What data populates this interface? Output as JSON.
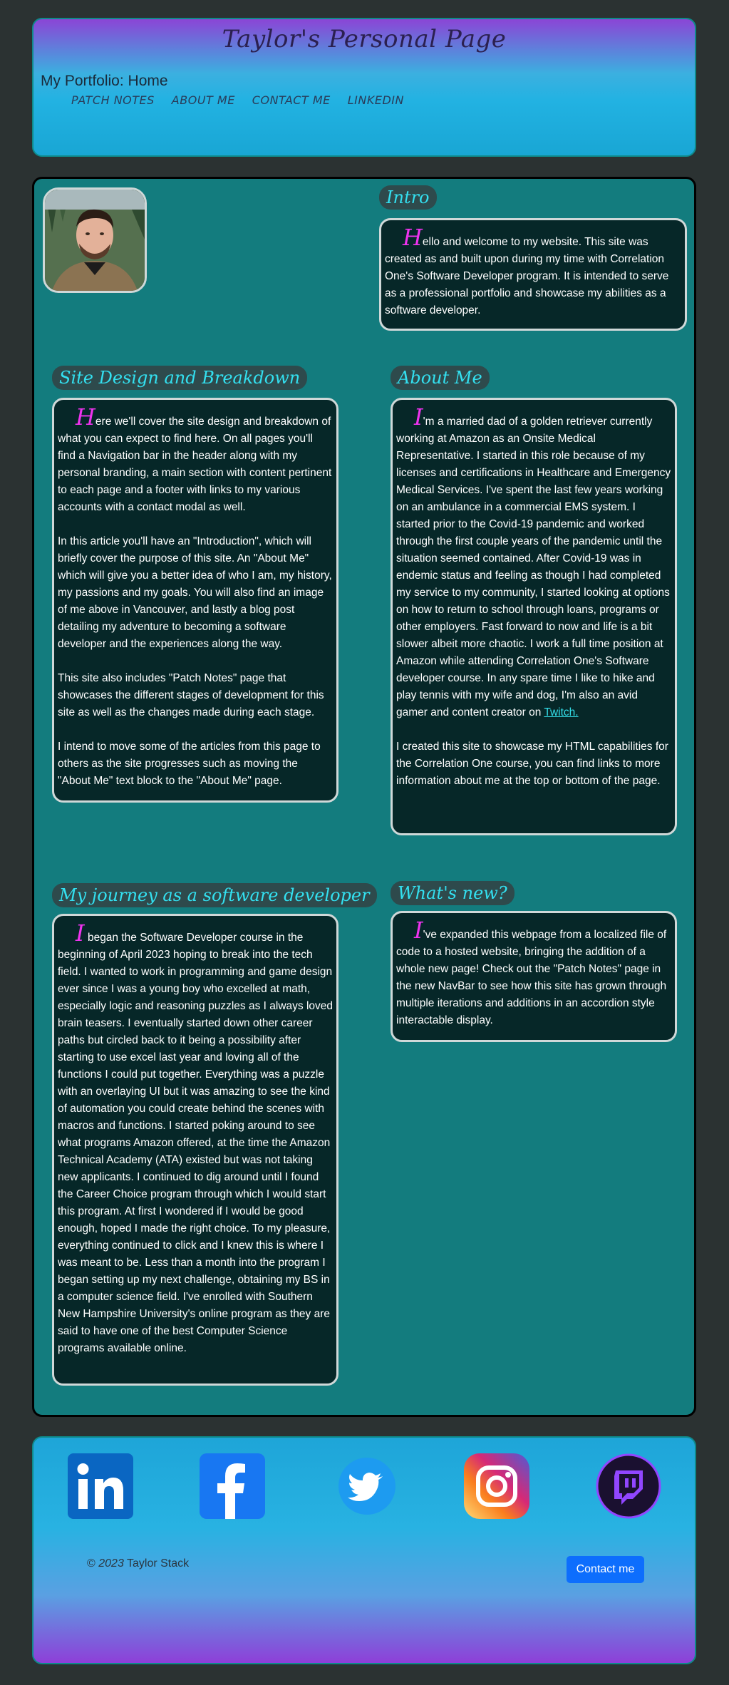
{
  "header": {
    "title": "Taylor's Personal Page",
    "brand": "My Portfolio: Home",
    "nav": [
      "PATCH NOTES",
      "ABOUT ME",
      "CONTACT ME",
      "LINKEDIN"
    ]
  },
  "intro": {
    "heading": "Intro",
    "dropcap": "H",
    "text": "ello and welcome to my website. This site was created as and built upon during my time with Correlation One's Software Developer program. It is intended to serve as a professional portfolio and showcase my abilities as a software developer."
  },
  "site_design": {
    "heading": "Site Design and Breakdown",
    "dropcap": "H",
    "p1": "ere we'll cover the site design and breakdown of what you can expect to find here. On all pages you'll find a Navigation bar in the header along with my personal branding, a main section with content pertinent to each page and a footer with links to my various accounts with a contact modal as well.",
    "p2": "In this article you'll have an \"Introduction\", which will briefly cover the purpose of this site. An \"About Me\" which will give you a better idea of who I am, my history, my passions and my goals. You will also find an image of me above in Vancouver, and lastly a blog post detailing my adventure to becoming a software developer and the experiences along the way.",
    "p3": "This site also includes \"Patch Notes\" page that showcases the different stages of development for this site as well as the changes made during each stage.",
    "p4": "I intend to move some of the articles from this page to others as the site progresses such as moving the \"About Me\" text block to the \"About Me\" page."
  },
  "about": {
    "heading": "About Me",
    "dropcap": "I",
    "p1": "'m a married dad of a golden retriever currently working at Amazon as an Onsite Medical Representative. I started in this role because of my licenses and certifications in Healthcare and Emergency Medical Services. I've spent the last few years working on an ambulance in a commercial EMS system. I started prior to the Covid-19 pandemic and worked through the first couple years of the pandemic until the situation seemed contained. After Covid-19 was in endemic status and feeling as though I had completed my service to my community, I started looking at options on how to return to school through loans, programs or other employers. Fast forward to now and life is a bit slower albeit more chaotic. I work a full time position at Amazon while attending Correlation One's Software developer course. In any spare time I like to hike and play tennis with my wife and dog, I'm also an avid gamer and content creator on ",
    "link": "Twitch.",
    "p2": "I created this site to showcase my HTML capabilities for the Correlation One course, you can find links to more information about me at the top or bottom of the page."
  },
  "journey": {
    "heading": "My journey as a software developer",
    "dropcap": "I",
    "text": " began the Software Developer course in the beginning of April 2023 hoping to break into the tech field. I wanted to work in programming and game design ever since I was a young boy who excelled at math, especially logic and reasoning puzzles as I always loved brain teasers. I eventually started down other career paths but circled back to it being a possibility after starting to use excel last year and loving all of the functions I could put together. Everything was a puzzle with an overlaying UI but it was amazing to see the kind of automation you could create behind the scenes with macros and functions. I started poking around to see what programs Amazon offered, at the time the Amazon Technical Academy (ATA) existed but was not taking new applicants. I continued to dig around until I found the Career Choice program through which I would start this program. At first I wondered if I would be good enough, hoped I made the right choice. To my pleasure, everything continued to click and I knew this is where I was meant to be. Less than a month into the program I began setting up my next challenge, obtaining my BS in a computer science field. I've enrolled with Southern New Hampshire University's online program as they are said to have one of the best Computer Science programs available online."
  },
  "whats_new": {
    "heading": "What's new?",
    "dropcap": "I",
    "text": "'ve expanded this webpage from a localized file of code to a hosted website, bringing the addition of a whole new page! Check out the \"Patch Notes\" page in the new NavBar to see how this site has grown through multiple iterations and additions in an accordion style interactable display."
  },
  "footer": {
    "social": [
      "linkedin-icon",
      "facebook-icon",
      "twitter-icon",
      "instagram-icon",
      "twitch-icon"
    ],
    "copyright_symbol": "©",
    "copyright_year": "2023",
    "copyright_name": "Taylor Stack",
    "contact_label": "Contact me"
  },
  "colors": {
    "main_bg": "#137c7e",
    "card_bg": "#062728",
    "heading": "#33e0f0",
    "dropcap": "#ee33ee",
    "button": "#0d6efd"
  }
}
